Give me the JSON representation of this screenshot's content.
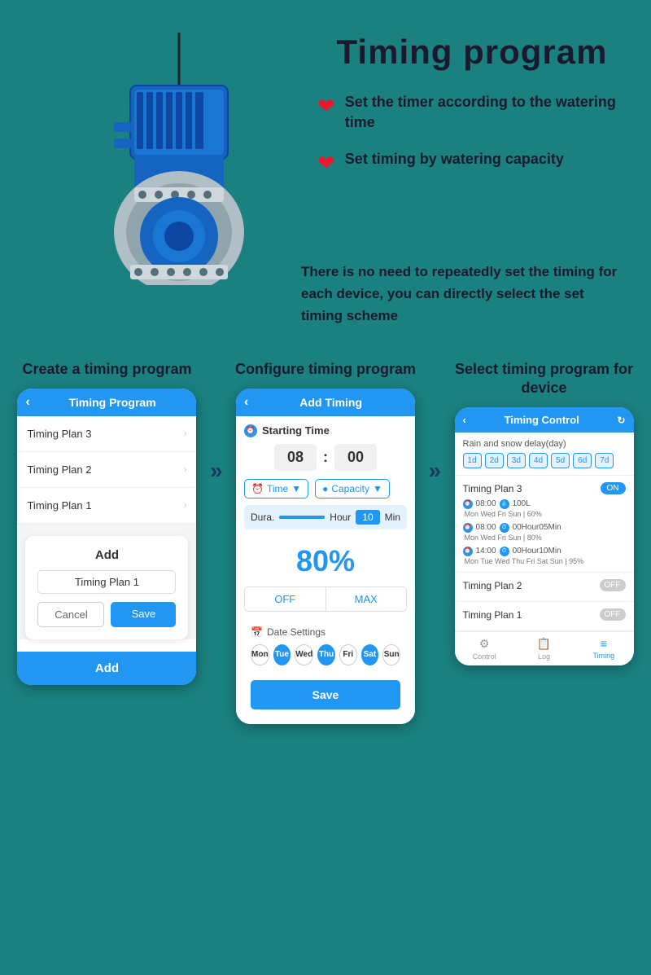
{
  "page": {
    "title": "Timing program",
    "bg_color": "#1a8080"
  },
  "features": [
    {
      "id": "feature1",
      "text": "Set the timer according to the watering time"
    },
    {
      "id": "feature2",
      "text": "Set timing by watering capacity"
    }
  ],
  "description": {
    "text": "There is no need to repeatedly set the timing for each device, you can directly select the set timing scheme"
  },
  "phone1": {
    "label": "Create a timing program",
    "header_title": "Timing Program",
    "plans": [
      "Timing Plan 3",
      "Timing Plan 2",
      "Timing Plan 1"
    ],
    "dialog": {
      "add_label": "Add",
      "input_value": "Timing Plan 1",
      "cancel": "Cancel",
      "save": "Save"
    },
    "footer": "Add"
  },
  "phone2": {
    "label": "Configure timing program",
    "header_title": "Add Timing",
    "starting_time_label": "Starting Time",
    "hour": "08",
    "minute": "00",
    "mode_time": "Time",
    "mode_capacity": "Capacity",
    "dura_label": "Dura.",
    "dura_unit_hour": "Hour",
    "dura_unit_min": "Min",
    "dura_val": "10",
    "percent": "80%",
    "off_label": "OFF",
    "max_label": "MAX",
    "date_settings_label": "Date Settings",
    "days": [
      {
        "label": "Mon",
        "active": false
      },
      {
        "label": "Tue",
        "active": true
      },
      {
        "label": "Wed",
        "active": false
      },
      {
        "label": "Thu",
        "active": true
      },
      {
        "label": "Fri",
        "active": false
      },
      {
        "label": "Sat",
        "active": true
      },
      {
        "label": "Sun",
        "active": false
      }
    ],
    "save_btn": "Save"
  },
  "phone3": {
    "label": "Select timing program for device",
    "header_title": "Timing Control",
    "rain_delay_label": "Rain and snow delay(day)",
    "delay_days": [
      "1d",
      "2d",
      "3d",
      "4d",
      "5d",
      "6d",
      "7d"
    ],
    "plans": [
      {
        "name": "Timing Plan 3",
        "toggle": "ON",
        "active": true,
        "details": [
          {
            "time": "08:00",
            "val": "100L",
            "days": "Mon Wed Fri Sun | 60%"
          },
          {
            "time": "08:00",
            "val": "00Hour05Min",
            "days": "Mon Wed Fri Sun | 80%"
          },
          {
            "time": "14:00",
            "val": "00Hour10Min",
            "days": "Mon Tue Wed Thu Fri Sat Sun | 95%"
          }
        ]
      },
      {
        "name": "Timing Plan 2",
        "toggle": "OFF",
        "active": false,
        "details": []
      },
      {
        "name": "Timing Plan 1",
        "toggle": "OFF",
        "active": false,
        "details": []
      }
    ],
    "nav_items": [
      "Control",
      "Log",
      "Timing"
    ]
  },
  "arrow": "»"
}
